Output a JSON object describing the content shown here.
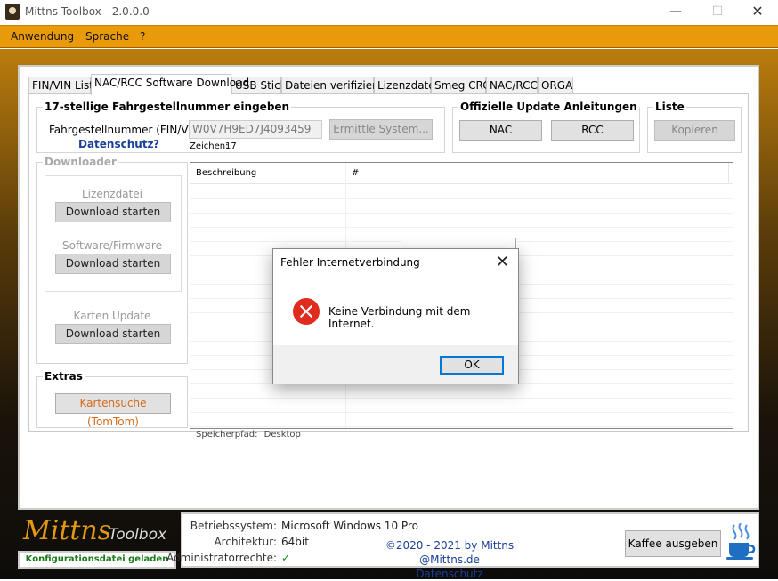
{
  "window": {
    "title": "Mittns Toolbox - 2.0.0.0",
    "minimize": "—",
    "maximize": "☐",
    "close": "✕"
  },
  "menu": [
    "Anwendung",
    "Sprache",
    "?"
  ],
  "tabs": [
    "FIN/VIN Liste",
    "NAC/RCC Software Download",
    "USB Stick",
    "Dateien verifizieren",
    "Lizenzdatei",
    "Smeg CRC",
    "NAC/RCC",
    "ORGA"
  ],
  "active_tab": "NAC/RCC Software Download",
  "vin_group": {
    "title": "17-stellige Fahrgestellnummer eingeben",
    "label": "Fahrgestellnummer (FIN/VIN):",
    "value": "W0V7H9ED7J4093459",
    "detect_button": "Ermittle System...",
    "privacy_link": "Datenschutz",
    "help_link": "?",
    "chars_label": "Zeichen:",
    "chars_value": "17"
  },
  "updates_group": {
    "title": "Offizielle Update Anleitungen",
    "nac_button": "NAC",
    "rcc_button": "RCC"
  },
  "list_group": {
    "title": "Liste",
    "copy_button": "Kopieren"
  },
  "downloader": {
    "title": "Downloader",
    "license_label": "Lizenzdatei",
    "license_button": "Download starten",
    "software_label": "Software/Firmware",
    "software_button": "Download starten",
    "maps_label": "Karten Update",
    "maps_button": "Download starten"
  },
  "extras": {
    "title": "Extras",
    "map_search_button": "Kartensuche (TomTom)"
  },
  "listview": {
    "columns": [
      "Beschreibung",
      "#"
    ]
  },
  "storage": {
    "label": "Speicherpfad:",
    "value": "Desktop"
  },
  "logo": {
    "mittns": "Mittns",
    "toolbox": "Toolbox"
  },
  "config_status": "Konfigurationsdatei geladen",
  "sysinfo": {
    "os_label": "Betriebssystem:",
    "os_value": "Microsoft Windows 10 Pro",
    "arch_label": "Architektur:",
    "arch_value": "64bit",
    "admin_label": "Administratorrechte:",
    "admin_value": "✓"
  },
  "copyright": {
    "line1": "©2020 - 2021 by Mittns @Mittns.de",
    "line2": "Datenschutz"
  },
  "coffee_button": "Kaffee ausgeben",
  "dialog": {
    "title": "Fehler Internetverbindung",
    "message": "Keine Verbindung mit dem Internet.",
    "ok_button": "OK",
    "close": "✕"
  },
  "colors": {
    "accent": "#e99a0a",
    "link": "#1a3f99",
    "success": "#1a7a1a",
    "error": "#e02b1f"
  }
}
